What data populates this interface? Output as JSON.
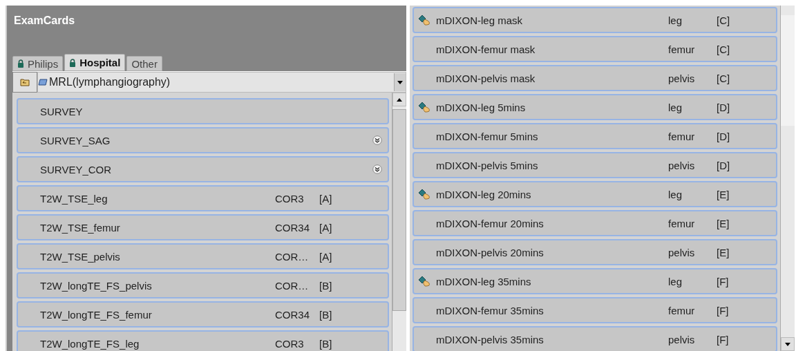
{
  "title": "ExamCards",
  "tabs": [
    {
      "label": "Philips",
      "locked": true,
      "selected": false
    },
    {
      "label": "Hospital",
      "locked": true,
      "selected": true
    },
    {
      "label": "Other",
      "locked": false,
      "selected": false
    }
  ],
  "exam_card": {
    "value": "MRL(lymphangiography)"
  },
  "left_rows": [
    {
      "name": "SURVEY",
      "orientation": "",
      "group": "",
      "expandable": false
    },
    {
      "name": "SURVEY_SAG",
      "orientation": "",
      "group": "",
      "expandable": true
    },
    {
      "name": "SURVEY_COR",
      "orientation": "",
      "group": "",
      "expandable": true
    },
    {
      "name": "T2W_TSE_leg",
      "orientation": "COR3",
      "group": "[A]",
      "expandable": false
    },
    {
      "name": "T2W_TSE_femur",
      "orientation": "COR34",
      "group": "[A]",
      "expandable": false
    },
    {
      "name": "T2W_TSE_pelvis",
      "orientation": "COR…",
      "group": "[A]",
      "expandable": false
    },
    {
      "name": "T2W_longTE_FS_pelvis",
      "orientation": "COR…",
      "group": "[B]",
      "expandable": false
    },
    {
      "name": "T2W_longTE_FS_femur",
      "orientation": "COR34",
      "group": "[B]",
      "expandable": false
    },
    {
      "name": "T2W_longTE_FS_leg",
      "orientation": "COR3",
      "group": "[B]",
      "expandable": false
    }
  ],
  "right_rows": [
    {
      "name": "mDIXON-leg mask",
      "region": "leg",
      "group": "[C]",
      "linked": true
    },
    {
      "name": "mDIXON-femur mask",
      "region": "femur",
      "group": "[C]",
      "linked": false
    },
    {
      "name": "mDIXON-pelvis mask",
      "region": "pelvis",
      "group": "[C]",
      "linked": false
    },
    {
      "name": "mDIXON-leg 5mins",
      "region": "leg",
      "group": "[D]",
      "linked": true
    },
    {
      "name": "mDIXON-femur 5mins",
      "region": "femur",
      "group": "[D]",
      "linked": false
    },
    {
      "name": "mDIXON-pelvis 5mins",
      "region": "pelvis",
      "group": "[D]",
      "linked": false
    },
    {
      "name": "mDIXON-leg 20mins",
      "region": "leg",
      "group": "[E]",
      "linked": true
    },
    {
      "name": "mDIXON-femur 20mins",
      "region": "femur",
      "group": "[E]",
      "linked": false
    },
    {
      "name": "mDIXON-pelvis 20mins",
      "region": "pelvis",
      "group": "[E]",
      "linked": false
    },
    {
      "name": "mDIXON-leg 35mins",
      "region": "leg",
      "group": "[F]",
      "linked": true
    },
    {
      "name": "mDIXON-femur 35mins",
      "region": "femur",
      "group": "[F]",
      "linked": false
    },
    {
      "name": "mDIXON-pelvis 35mins",
      "region": "pelvis",
      "group": "[F]",
      "linked": false
    }
  ]
}
